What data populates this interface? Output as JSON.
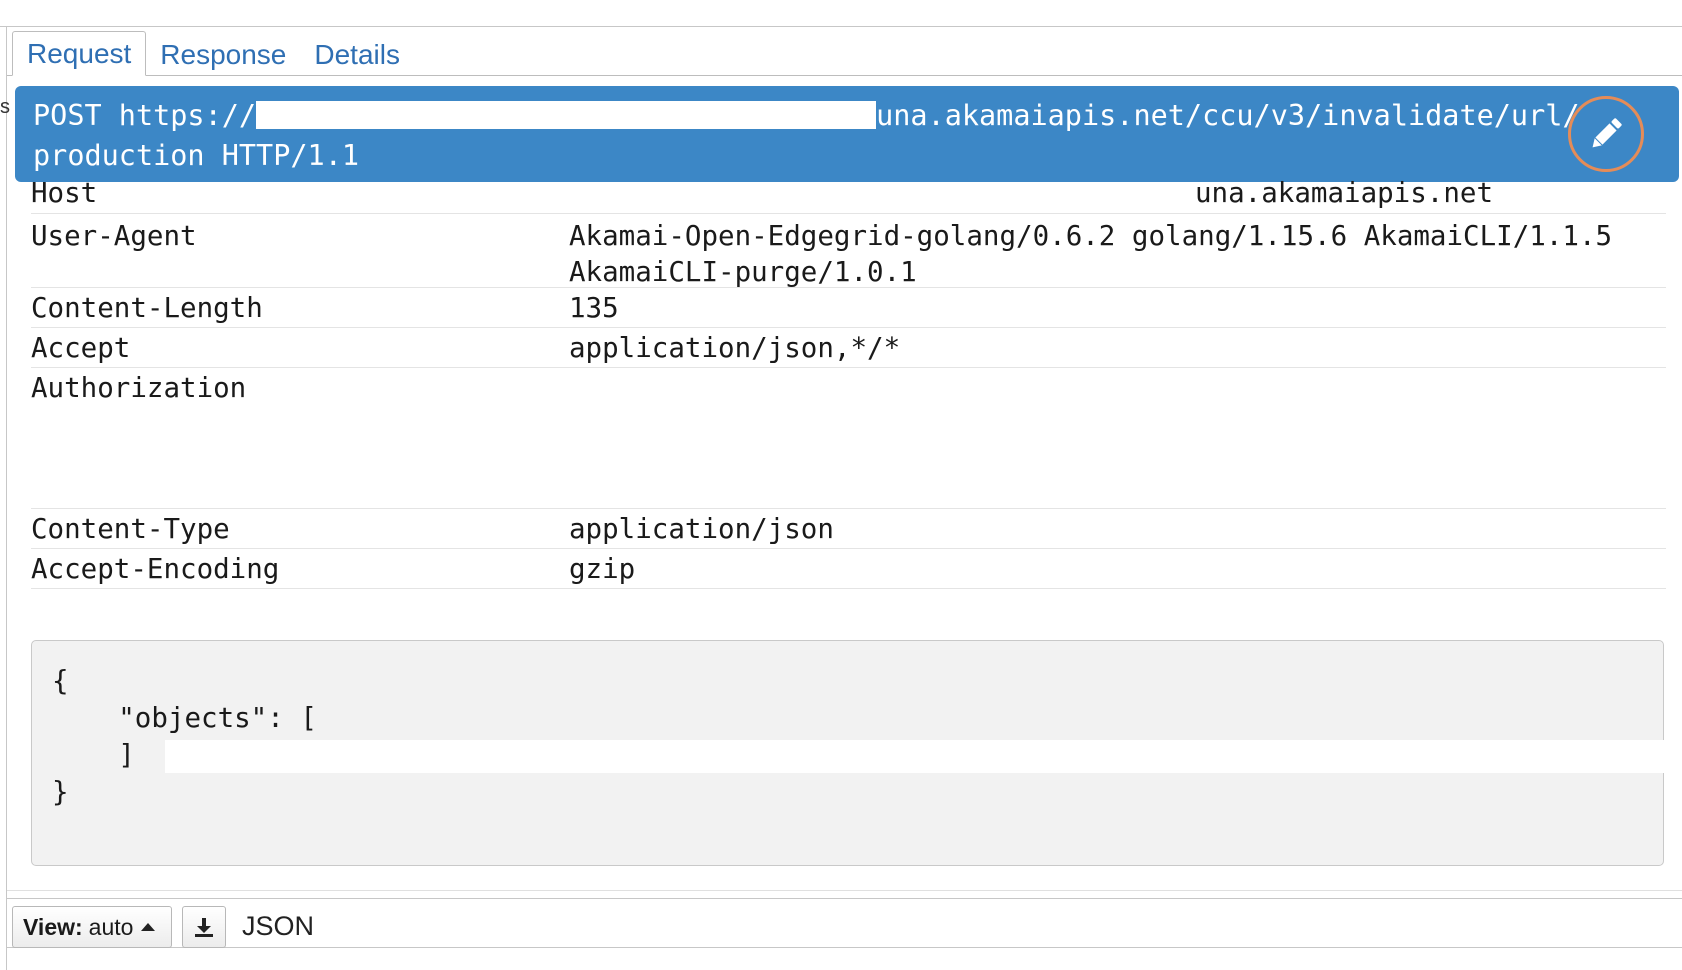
{
  "tabs": {
    "request": "Request",
    "response": "Response",
    "details": "Details"
  },
  "request_line": {
    "method_and_scheme": "POST https://",
    "host_suffix_and_path": "una.akamaiapis.net/ccu/v3/invalidate/url/production HTTP/1.1"
  },
  "headers": [
    {
      "name": "Host",
      "value": "una.akamaiapis.net"
    },
    {
      "name": "User-Agent",
      "value": "Akamai-Open-Edgegrid-golang/0.6.2 golang/1.15.6 AkamaiCLI/1.1.5 AkamaiCLI-purge/1.0.1"
    },
    {
      "name": "Content-Length",
      "value": "135"
    },
    {
      "name": "Accept",
      "value": "application/json,*/*"
    },
    {
      "name": "Authorization",
      "value": ""
    },
    {
      "name": "Content-Type",
      "value": "application/json"
    },
    {
      "name": "Accept-Encoding",
      "value": "gzip"
    }
  ],
  "body": {
    "line1": "{",
    "line2": "    \"objects\": [",
    "line3": "",
    "line4": "    ]",
    "line5": "}"
  },
  "footer": {
    "view_label": "View:",
    "view_value": "auto",
    "format": "JSON"
  },
  "icons": {
    "edit": "pencil-icon",
    "download": "download-icon",
    "view_caret": "caret-up-icon"
  },
  "colors": {
    "accent": "#3c87c6",
    "tab_text": "#2f6fb3",
    "edit_ring": "#e58c58"
  }
}
